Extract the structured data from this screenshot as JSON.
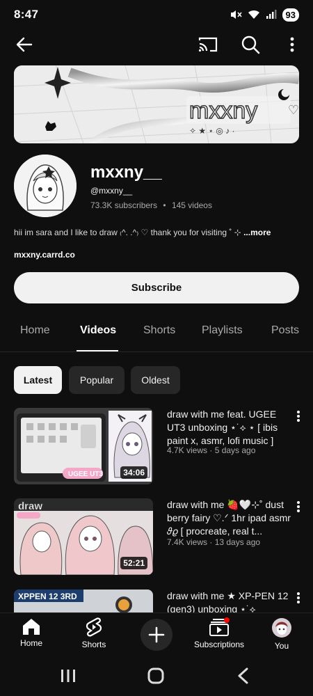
{
  "status_bar": {
    "time": "8:47",
    "battery": "93"
  },
  "app_bar": {
    "back_icon": "back-arrow-icon",
    "cast_icon": "cast-icon",
    "search_icon": "search-icon",
    "more_icon": "more-vert-icon"
  },
  "banner": {
    "text": "mxxny"
  },
  "channel": {
    "name": "mxxny__",
    "handle": "@mxxny__",
    "subscribers": "73.3K subscribers",
    "separator": "•",
    "videos_count": "145 videos",
    "description": "hii im sara and I like to draw ₍^. .^₎ ♡ thank you for visiting ˚ ⊹ ",
    "more": "...more",
    "link": "mxxny.carrd.co",
    "subscribe_label": "Subscribe"
  },
  "tabs": [
    {
      "label": "Home"
    },
    {
      "label": "Videos",
      "active": true
    },
    {
      "label": "Shorts"
    },
    {
      "label": "Playlists"
    },
    {
      "label": "Posts"
    }
  ],
  "chips": [
    {
      "label": "Latest",
      "active": true
    },
    {
      "label": "Popular"
    },
    {
      "label": "Oldest"
    }
  ],
  "videos": [
    {
      "title": "draw with me feat. UGEE UT3 unboxing ⋆˙⟡ ⋆ [ ibis paint x, asmr, lofi music ]",
      "meta": "4.7K views · 5 days ago",
      "duration": "34:06"
    },
    {
      "title": "draw with me 🍓🤍⊹˚ dust berry fairy ♡.ᐟ 1hr ipad asmr 𝜗𝜚 [ procreate, real t...",
      "meta": "7.4K views · 13 days ago",
      "duration": "52:21"
    },
    {
      "title": "draw with me ★ XP-PEN 12 (gen3) unboxing ⋆˙⟡",
      "meta": "",
      "duration": ""
    }
  ],
  "bottom_nav": [
    {
      "label": "Home",
      "icon": "home-icon"
    },
    {
      "label": "Shorts",
      "icon": "shorts-icon"
    },
    {
      "label": "",
      "icon": "create-icon"
    },
    {
      "label": "Subscriptions",
      "icon": "subscriptions-icon"
    },
    {
      "label": "You",
      "icon": "avatar-icon"
    }
  ],
  "colors": {
    "background": "#0f0f0f",
    "chip_bg": "#272727",
    "text_secondary": "#aaaaaa",
    "subscribe_bg": "#f1f1f1"
  }
}
